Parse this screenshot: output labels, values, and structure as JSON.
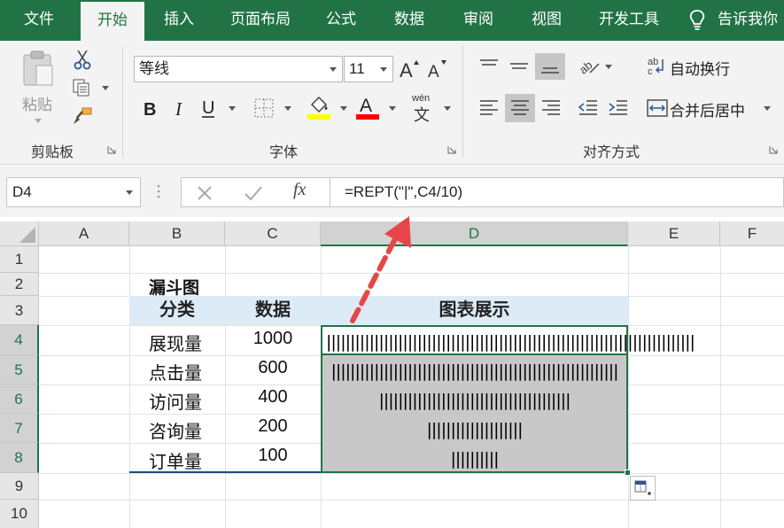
{
  "tabs": [
    "文件",
    "开始",
    "插入",
    "页面布局",
    "公式",
    "数据",
    "审阅",
    "视图",
    "开发工具"
  ],
  "active_tab": "开始",
  "tell_me": "告诉我你",
  "ribbon": {
    "clipboard": {
      "paste_label": "粘贴",
      "group_label": "剪贴板"
    },
    "font": {
      "font_name": "等线",
      "font_size": "11",
      "phonetic_label": "wén",
      "phonetic_char": "文",
      "group_label": "字体"
    },
    "alignment": {
      "wrap_text": "自动换行",
      "merge_center": "合并后居中",
      "group_label": "对齐方式"
    },
    "colors": {
      "accent": "#217346",
      "highlight_yellow": "#ffff00",
      "font_red": "#ff0000"
    }
  },
  "formula_bar": {
    "name_box": "D4",
    "fx": "fx",
    "formula": "=REPT(\"|\",C4/10)"
  },
  "columns": [
    "A",
    "B",
    "C",
    "D",
    "E",
    "F"
  ],
  "rows": [
    "1",
    "2",
    "3",
    "4",
    "5",
    "6",
    "7",
    "8",
    "9",
    "10"
  ],
  "sheet": {
    "title": "漏斗图",
    "headers": {
      "category": "分类",
      "data": "数据",
      "chart": "图表展示"
    },
    "rows": [
      {
        "category": "展现量",
        "value": "1000",
        "bar": "||||||||||||||||||||||||||||||||||||||||||||||||||||||||||||||||||||||||||||||||||||||||||||||||||||"
      },
      {
        "category": "点击量",
        "value": "600",
        "bar": "||||||||||||||||||||||||||||||||||||||||||||||||||||||||||||"
      },
      {
        "category": "访问量",
        "value": "400",
        "bar": "||||||||||||||||||||||||||||||||||||||||"
      },
      {
        "category": "咨询量",
        "value": "200",
        "bar": "||||||||||||||||||||"
      },
      {
        "category": "订单量",
        "value": "100",
        "bar": "||||||||||"
      }
    ]
  }
}
